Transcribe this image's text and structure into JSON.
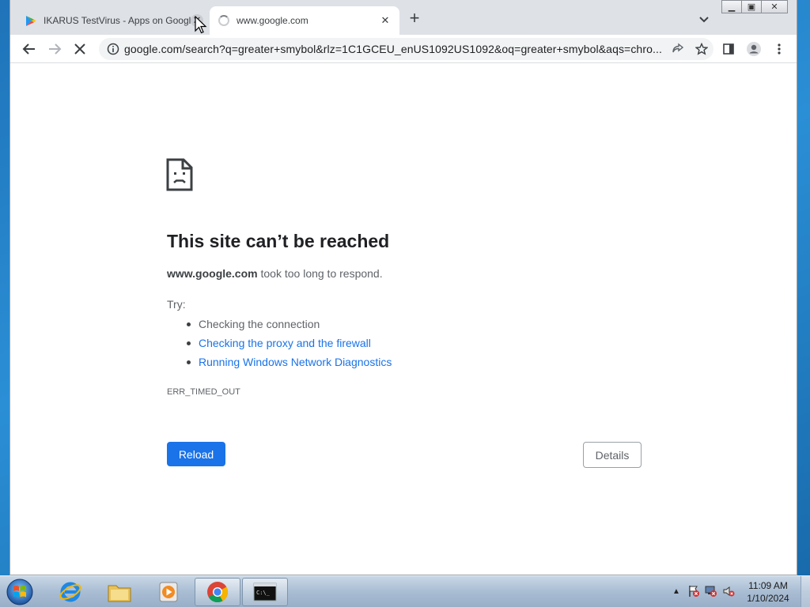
{
  "window": {
    "tabs": [
      {
        "title": "IKARUS TestVirus - Apps on Google Play",
        "favicon": "google-play-icon",
        "active": false
      },
      {
        "title": "www.google.com",
        "favicon": "loading-spinner-icon",
        "active": true
      }
    ],
    "new_tab_label": "+",
    "window_controls": [
      "minimize",
      "maximize",
      "close"
    ]
  },
  "toolbar": {
    "url": "google.com/search?q=greater+smybol&rlz=1C1GCEU_enUS1092US1092&oq=greater+smybol&aqs=chro..."
  },
  "error_page": {
    "title": "This site can’t be reached",
    "host": "www.google.com",
    "host_suffix": " took too long to respond.",
    "try_label": "Try:",
    "suggestions": [
      {
        "text": "Checking the connection",
        "link": false
      },
      {
        "text": "Checking the proxy and the firewall",
        "link": true
      },
      {
        "text": "Running Windows Network Diagnostics",
        "link": true
      }
    ],
    "error_code": "ERR_TIMED_OUT",
    "reload_label": "Reload",
    "details_label": "Details"
  },
  "taskbar": {
    "time": "11:09 AM",
    "date": "1/10/2024",
    "pinned": [
      "internet-explorer-icon",
      "file-explorer-icon",
      "media-player-icon",
      "chrome-icon",
      "command-prompt-icon"
    ]
  },
  "colors": {
    "accent": "#1a73e8",
    "link": "#1a73e8",
    "title_text": "#202124"
  }
}
